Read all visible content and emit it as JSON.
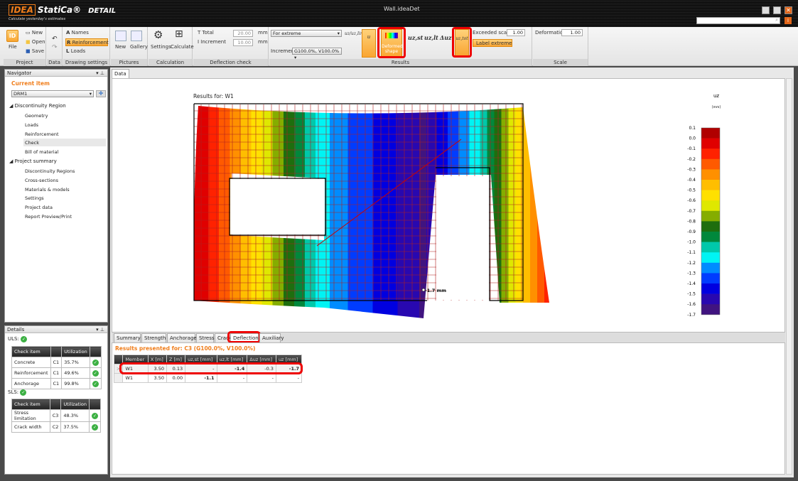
{
  "app": {
    "logo": "IDEA",
    "brand": "StatiCa®",
    "product": "DETAIL",
    "tagline": "Calculate yesterday's estimates",
    "window_title": "Wall.ideaDet"
  },
  "ribbon": {
    "project": {
      "label": "Project",
      "file": "File",
      "new": "New",
      "open": "Open",
      "save": "Save"
    },
    "data": {
      "label": "Data"
    },
    "drawing": {
      "label": "Drawing settings",
      "names": "Names",
      "reinforcement": "Reinforcement",
      "loads": "Loads"
    },
    "pictures": {
      "label": "Pictures",
      "new": "New",
      "gallery": "Gallery"
    },
    "calculation": {
      "label": "Calculation",
      "settings": "Settings",
      "calculate": "Calculate"
    },
    "deflection": {
      "label": "Deflection check",
      "total": "Total",
      "total_value": "20.00",
      "increment": "Increment",
      "increment_value": "10.00",
      "unit": "mm"
    },
    "results": {
      "label": "Results",
      "mode": "For extreme",
      "increment_label": "Increment",
      "increment_value": "G100.0%, V100.0%",
      "ratio": "uz/uz,lim",
      "u": "u",
      "deformed": "Deformed shape",
      "uzst": "uz,st",
      "uzlt": "uz,lt",
      "duz": "Δuz",
      "uztot": "uz,tot",
      "exceeded_scale": "Exceeded scale",
      "exceeded_value": "1.00",
      "label_extreme": "Label extreme"
    },
    "scale": {
      "label": "Scale",
      "deformation": "Deformation",
      "deformation_value": "1.00"
    }
  },
  "navigator": {
    "title": "Navigator",
    "current_item": "Current item",
    "selected": "DRM1",
    "groups": [
      {
        "label": "Discontinuity Region",
        "items": [
          "Geometry",
          "Loads",
          "Reinforcement",
          "Check",
          "Bill of material"
        ]
      },
      {
        "label": "Project summary",
        "items": [
          "Discontinuity Regions",
          "Cross-sections",
          "Materials & models",
          "Settings",
          "Project data",
          "Report Preview/Print"
        ]
      }
    ],
    "active": "Check"
  },
  "details": {
    "title": "Details",
    "uls_label": "ULS:",
    "sls_label": "SLS:",
    "headers": [
      "Check item",
      "",
      "Utilization",
      ""
    ],
    "uls": [
      [
        "Concrete",
        "C1",
        "35.7%"
      ],
      [
        "Reinforcement",
        "C1",
        "49.6%"
      ],
      [
        "Anchorage",
        "C1",
        "99.8%"
      ]
    ],
    "sls": [
      [
        "Stress limitation",
        "C3",
        "48.3%"
      ],
      [
        "Crack width",
        "C2",
        "37.5%"
      ]
    ]
  },
  "main": {
    "tab": "Data",
    "results_for": "Results for: W1",
    "annotation": "-1.7 mm",
    "legend": {
      "title": "uz",
      "unit": "[mm]",
      "labels": [
        "0.1",
        "0.0",
        "-0.1",
        "-0.2",
        "-0.3",
        "-0.4",
        "-0.5",
        "-0.6",
        "-0.7",
        "-0.8",
        "-0.9",
        "-1.0",
        "-1.1",
        "-1.2",
        "-1.3",
        "-1.4",
        "-1.5",
        "-1.6",
        "-1.7"
      ],
      "colors": [
        "#b00000",
        "#e00000",
        "#ff2200",
        "#ff5a00",
        "#ff9000",
        "#ffbe00",
        "#ffe000",
        "#dfe800",
        "#85ad00",
        "#1e6e0e",
        "#00883c",
        "#00c8aa",
        "#00f4f4",
        "#008cff",
        "#003cff",
        "#0000e0",
        "#2808b0",
        "#401480"
      ]
    },
    "bottom_tabs": [
      "Summary",
      "Strength",
      "Anchorage",
      "Stress",
      "Crack",
      "Deflection",
      "Auxiliary"
    ],
    "active_tab": "Deflection",
    "presented_for": "Results presented for: C3 (G100.0%, V100.0%)",
    "table": {
      "headers": [
        "Member",
        "X [m]",
        "Z [m]",
        "uz,st [mm]",
        "uz,lt [mm]",
        "Δuz [mm]",
        "uz [mm]"
      ],
      "rows": [
        [
          "W1",
          "3.50",
          "0.13",
          "-",
          "-1.4",
          "-0.3",
          "-1.7"
        ],
        [
          "W1",
          "3.50",
          "0.00",
          "-1.1",
          "-",
          "-",
          "-"
        ]
      ]
    }
  }
}
